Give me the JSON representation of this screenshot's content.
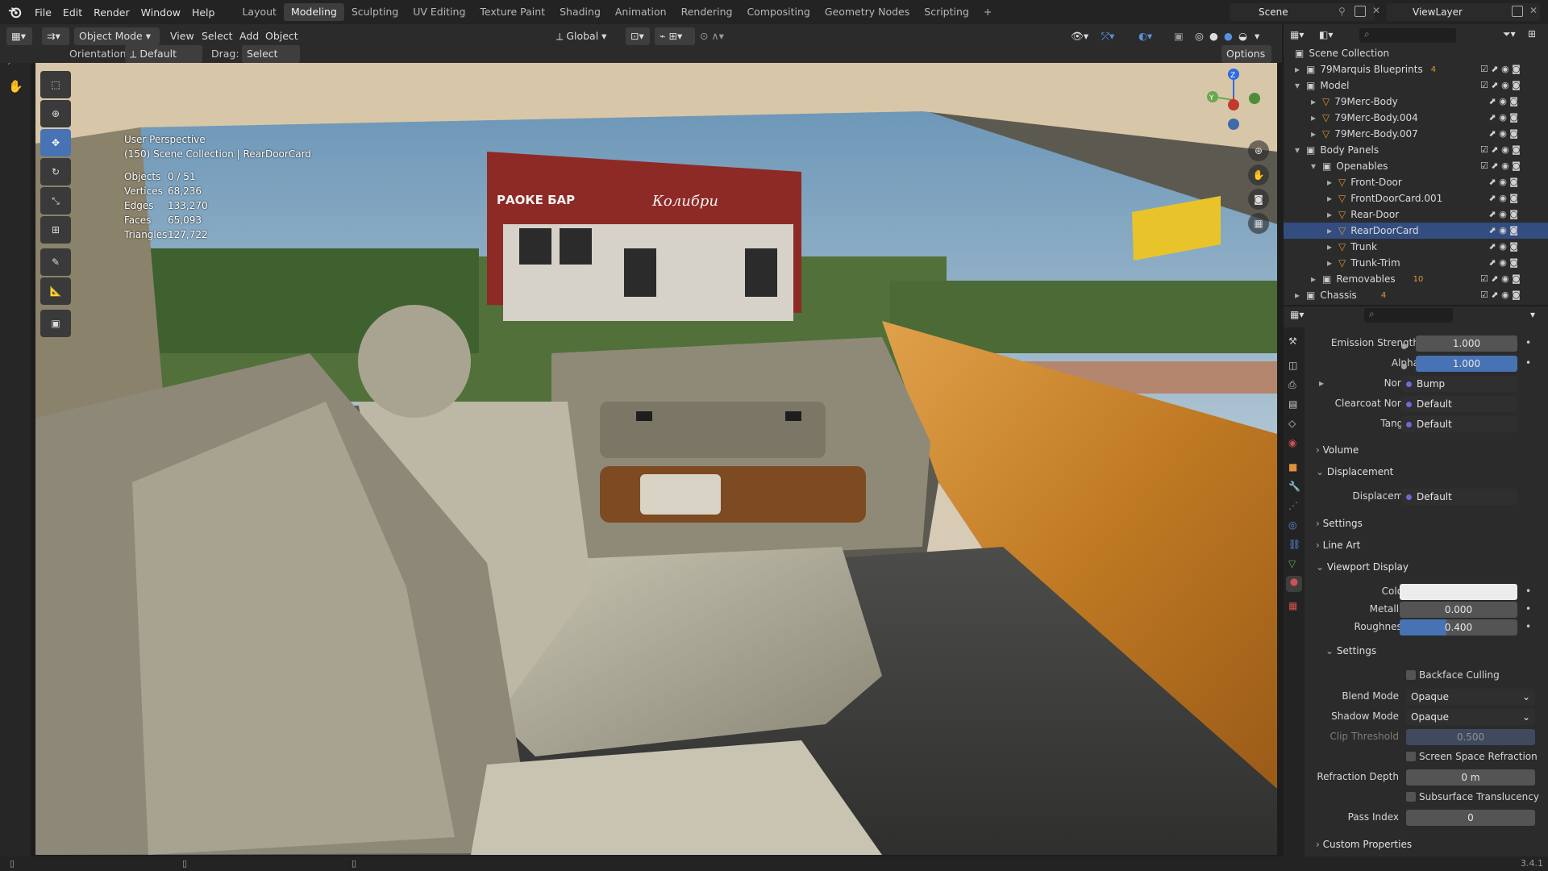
{
  "menu": [
    "File",
    "Edit",
    "Render",
    "Window",
    "Help"
  ],
  "workspaces": [
    "Layout",
    "Modeling",
    "Sculpting",
    "UV Editing",
    "Texture Paint",
    "Shading",
    "Animation",
    "Rendering",
    "Compositing",
    "Geometry Nodes",
    "Scripting"
  ],
  "active_workspace": "Modeling",
  "scene_name": "Scene",
  "view_layer": "ViewLayer",
  "header": {
    "mode": "Object Mode",
    "view": "View",
    "select": "Select",
    "add": "Add",
    "object": "Object",
    "transform_orientation": "Global",
    "orientation_label": "Orientation:",
    "orientation_value": "Default",
    "drag_label": "Drag:",
    "drag_value": "Select Box",
    "options": "Options"
  },
  "viewport": {
    "perspective": "User Perspective",
    "collection_path": "(150) Scene Collection | RearDoorCard",
    "stats": [
      {
        "k": "Objects",
        "v": "0 / 51"
      },
      {
        "k": "Vertices",
        "v": "68,236"
      },
      {
        "k": "Edges",
        "v": "133,270"
      },
      {
        "k": "Faces",
        "v": "65,093"
      },
      {
        "k": "Triangles",
        "v": "127,722"
      }
    ],
    "sign_text_1": "РАОКЕ  БАР",
    "sign_text_2": "Колибри"
  },
  "outliner": {
    "root": "Scene Collection",
    "rows": [
      {
        "label": "79Marquis Blueprints",
        "badge": "4"
      },
      {
        "label": "Model"
      },
      {
        "label": "79Merc-Body"
      },
      {
        "label": "79Merc-Body.004"
      },
      {
        "label": "79Merc-Body.007"
      },
      {
        "label": "Body Panels"
      },
      {
        "label": "Openables"
      },
      {
        "label": "Front-Door"
      },
      {
        "label": "FrontDoorCard.001"
      },
      {
        "label": "Rear-Door"
      },
      {
        "label": "RearDoorCard"
      },
      {
        "label": "Trunk"
      },
      {
        "label": "Trunk-Trim"
      },
      {
        "label": "Removables",
        "badge": "10"
      },
      {
        "label": "Chassis",
        "badge": "4"
      }
    ]
  },
  "properties": {
    "emission_strength_label": "Emission Strength",
    "emission_strength": "1.000",
    "alpha_label": "Alpha",
    "alpha": "1.000",
    "normal_label": "Normal",
    "normal": "Bump",
    "clearcoat_normal_label": "Clearcoat Normal",
    "clearcoat_normal": "Default",
    "tangent_label": "Tangent",
    "tangent": "Default",
    "sec_volume": "Volume",
    "sec_displacement": "Displacement",
    "displacement_label": "Displacement",
    "displacement": "Default",
    "sec_settings": "Settings",
    "sec_line_art": "Line Art",
    "sec_viewport_display": "Viewport Display",
    "color_label": "Color",
    "metallic_label": "Metallic",
    "metallic": "0.000",
    "roughness_label": "Roughness",
    "roughness": "0.400",
    "roughness_fraction": 0.4,
    "sub_settings": "Settings",
    "backface_culling": "Backface Culling",
    "blend_mode_label": "Blend Mode",
    "blend_mode": "Opaque",
    "shadow_mode_label": "Shadow Mode",
    "shadow_mode": "Opaque",
    "clip_threshold_label": "Clip Threshold",
    "clip_threshold": "0.500",
    "screen_space_refraction": "Screen Space Refraction",
    "refraction_depth_label": "Refraction Depth",
    "refraction_depth": "0 m",
    "subsurface_translucency": "Subsurface Translucency",
    "pass_index_label": "Pass Index",
    "pass_index": "0",
    "sec_custom_properties": "Custom Properties"
  },
  "version": "3.4.1",
  "colors": {
    "accent": "#4772b3",
    "selected_row": "#334d80",
    "panel": "#2b2b2b",
    "field": "#545454",
    "wood": "#c6892f"
  }
}
